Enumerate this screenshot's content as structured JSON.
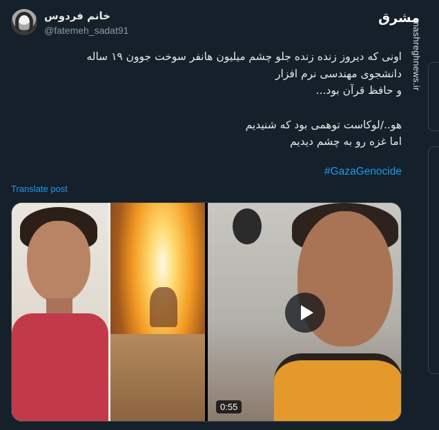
{
  "author": {
    "display_name": "خانم فردوس",
    "handle": "@fatemeh_sadat91"
  },
  "brand": {
    "logo_text": "مشرق",
    "site": "mashreghnews.ir"
  },
  "tweet": {
    "lines": [
      "اونی که دیروز زنده زنده جلو چشم میلیون هانفر سوخت جوون ۱۹ ساله",
      "دانشجوی مهندسی نرم افزار",
      "و حافظ قرآن بود...",
      "هو../لوکاست توهمی بود که شنیدیم",
      "اما غزه رو به چشم دیدیم"
    ],
    "hashtag": "#GazaGenocide",
    "translate_label": "Translate post"
  },
  "media": {
    "video_duration": "0:55"
  },
  "colors": {
    "background": "#15202b",
    "accent": "#1d9bf0"
  }
}
